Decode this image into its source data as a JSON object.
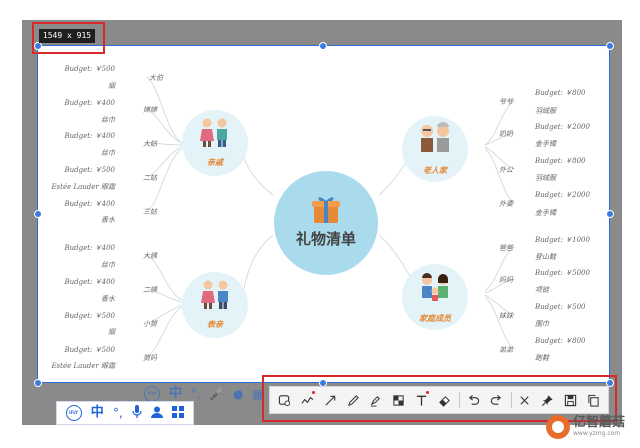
{
  "size_readout": "1549 x 915",
  "mindmap": {
    "center": "礼物清单",
    "branches": {
      "relatives": {
        "title": "亲戚",
        "items": [
          {
            "rel": "大伯",
            "budget": "Budget: ￥500",
            "gift": "烟"
          },
          {
            "rel": "婶婶",
            "budget": "Budget: ￥400",
            "gift": "丝巾"
          },
          {
            "rel": "大姑",
            "budget": "Budget: ￥400",
            "gift": "丝巾"
          },
          {
            "rel": "二姑",
            "budget": "Budget: ￥500",
            "gift": "Estée Lauder 眼霜"
          },
          {
            "rel": "三姑",
            "budget": "Budget: ￥400",
            "gift": "香水"
          }
        ]
      },
      "cousins": {
        "title": "表亲",
        "items": [
          {
            "rel": "大姨",
            "budget": "Budget: ￥400",
            "gift": "丝巾"
          },
          {
            "rel": "二姨",
            "budget": "Budget: ￥400",
            "gift": "香水"
          },
          {
            "rel": "小舅",
            "budget": "Budget: ￥500",
            "gift": "烟"
          },
          {
            "rel": "舅妈",
            "budget": "Budget: ￥500",
            "gift": "Estée Lauder 眼霜"
          }
        ]
      },
      "elders": {
        "title": "老人家",
        "items": [
          {
            "rel": "爷爷",
            "budget": "Budget: ￥800",
            "gift": "羽绒服"
          },
          {
            "rel": "奶奶",
            "budget": "Budget: ￥2000",
            "gift": "金手镯"
          },
          {
            "rel": "外公",
            "budget": "Budget: ￥800",
            "gift": "羽绒服"
          },
          {
            "rel": "外婆",
            "budget": "Budget: ￥2000",
            "gift": "金手镯"
          }
        ]
      },
      "family": {
        "title": "家庭成员",
        "items": [
          {
            "rel": "爸爸",
            "budget": "Budget: ￥1000",
            "gift": "登山鞋"
          },
          {
            "rel": "妈妈",
            "budget": "Budget: ￥5000",
            "gift": "项链"
          },
          {
            "rel": "妹妹",
            "budget": "Budget: ￥500",
            "gift": "围巾"
          },
          {
            "rel": "弟弟",
            "budget": "Budget: ￥800",
            "gift": "跑鞋"
          }
        ]
      }
    }
  },
  "ime_bar": {
    "brand": "iFLY",
    "lang": "中",
    "icons": [
      "punctuation-icon",
      "microphone-icon",
      "user-icon",
      "grid-icon"
    ]
  },
  "toolbar": {
    "tools": [
      "rectangle-icon",
      "freehand-line-icon",
      "arrow-icon",
      "pen-icon",
      "marker-icon",
      "mosaic-icon",
      "text-icon",
      "eraser-icon",
      "undo-icon",
      "redo-icon",
      "close-icon",
      "pin-icon",
      "save-icon",
      "copy-icon"
    ]
  },
  "watermark": {
    "main": "亿智蘑菇",
    "sub": "www.yzmg.com"
  },
  "colors": {
    "selection": "#2b6fd6",
    "highlight": "#d42a2a",
    "center_fill": "#a9dbec",
    "branch_fill": "#e4f3f8",
    "branch_text": "#e58a38"
  }
}
